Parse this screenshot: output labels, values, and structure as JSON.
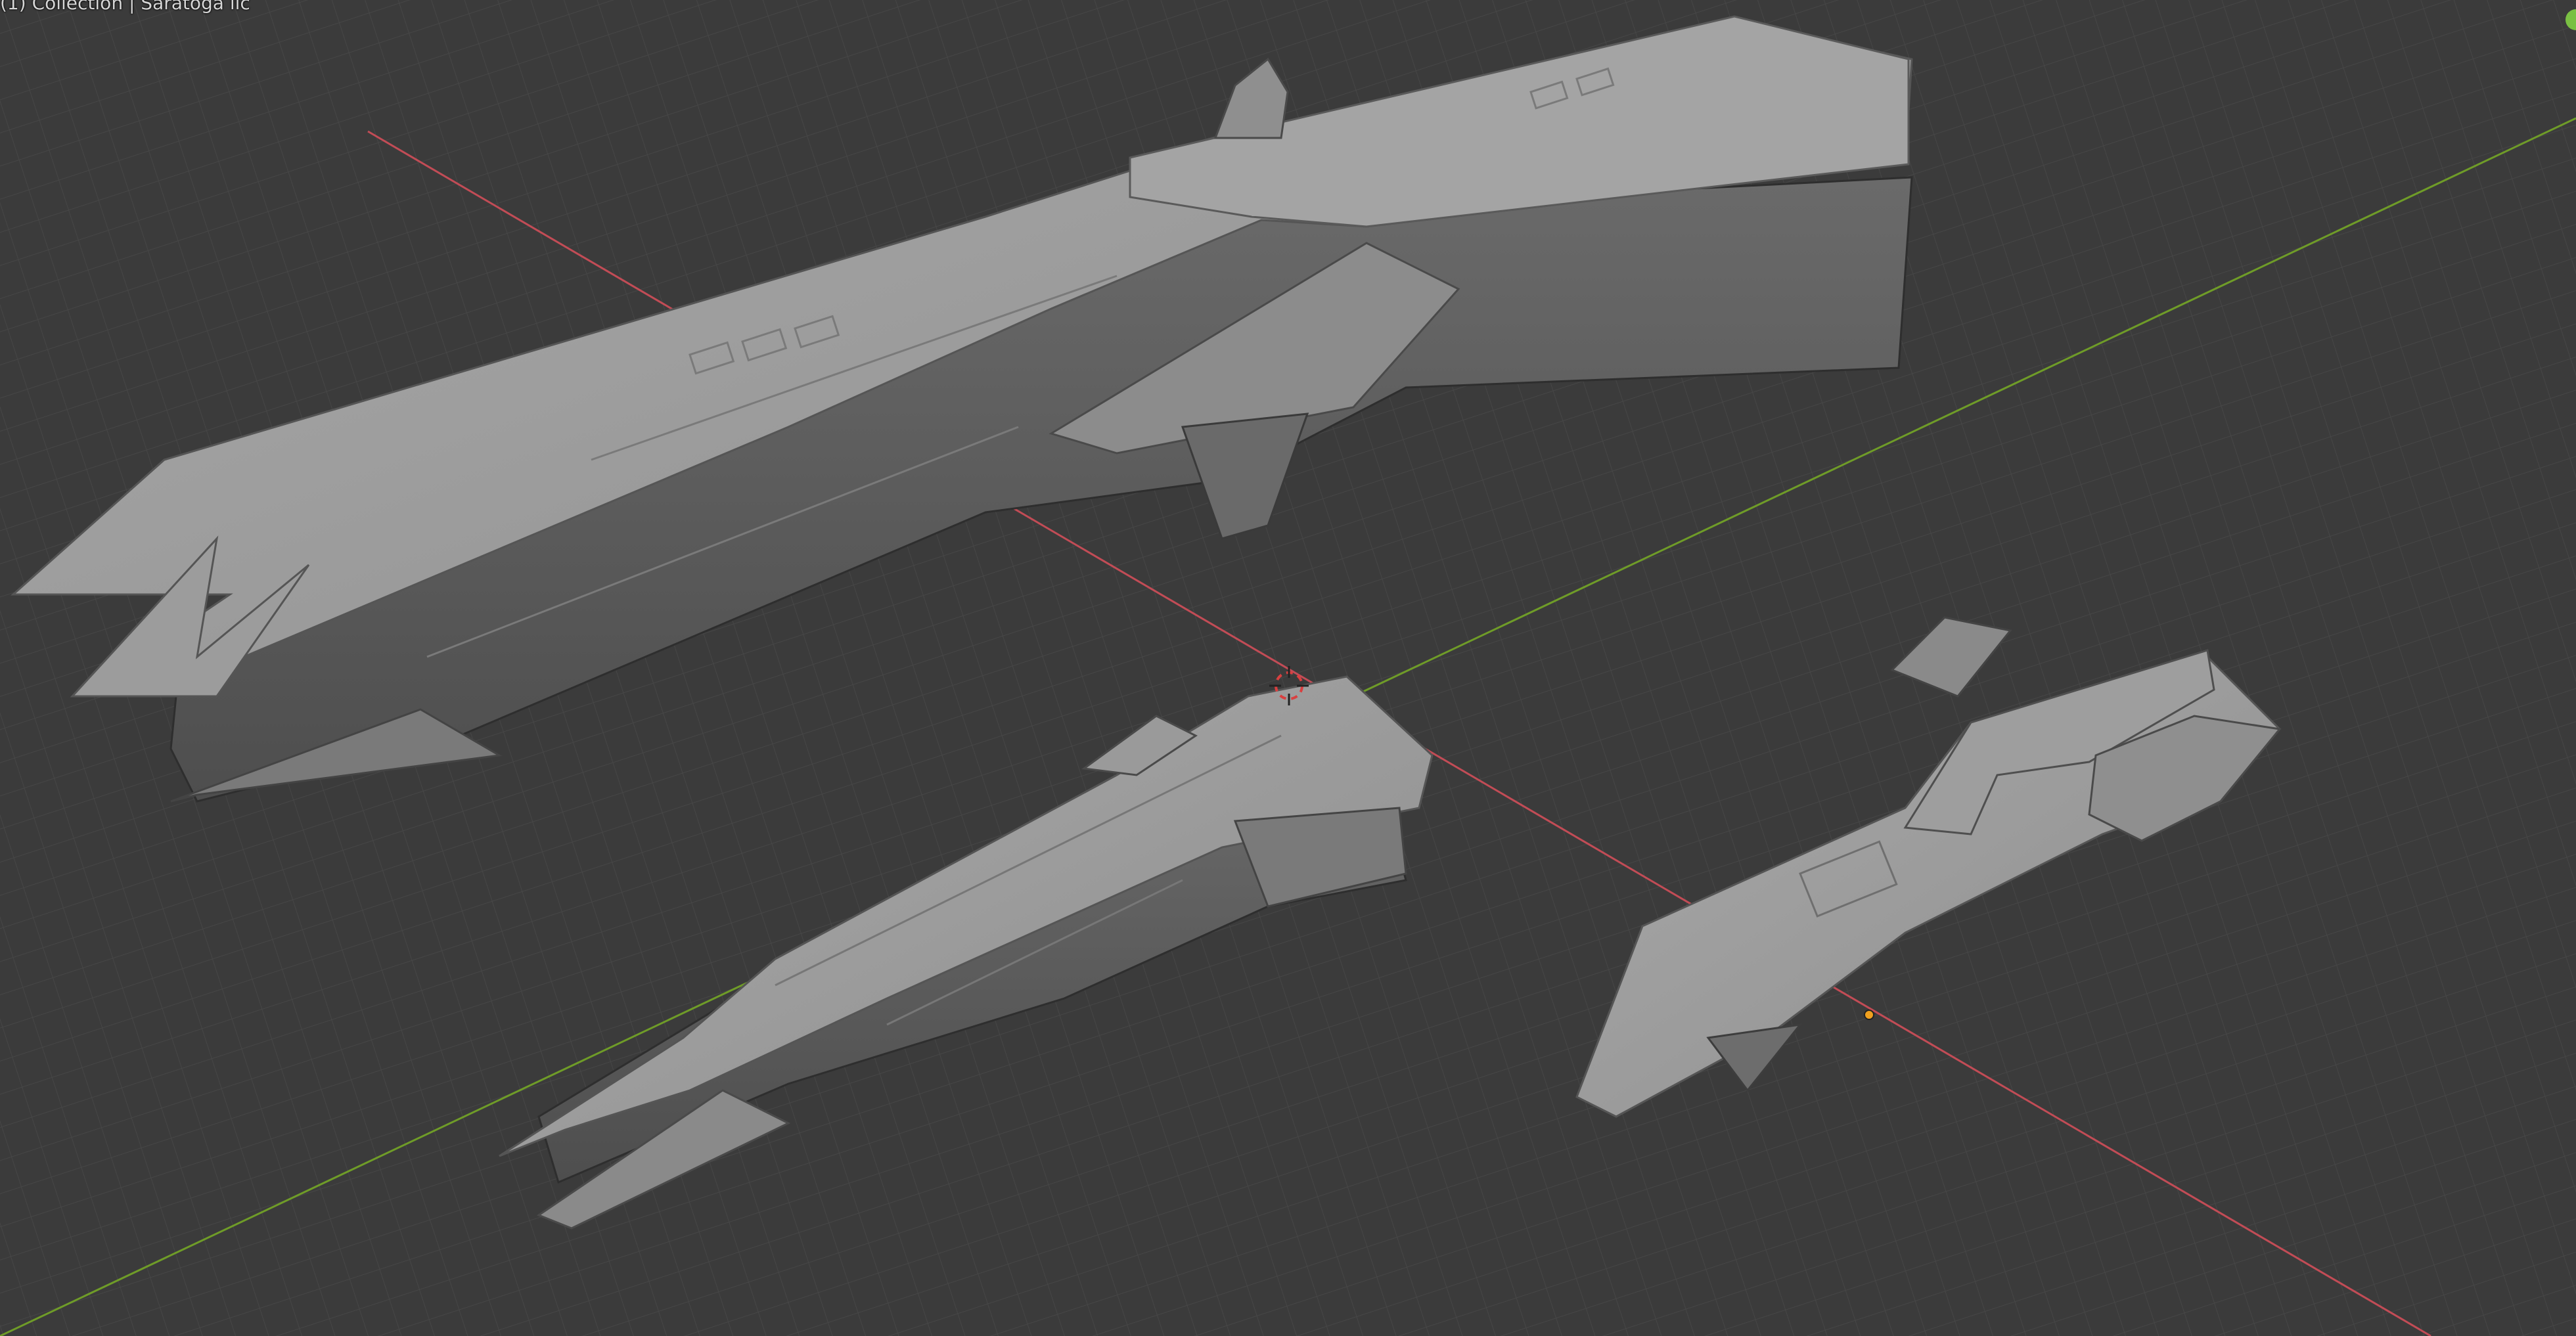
{
  "viewport": {
    "overlay_text": "(1) Collection | Saratoga llc",
    "background_color": "#3b3b3b",
    "grid_color": "#454545",
    "x_axis_color": "#c24c56",
    "y_axis_color": "#6f9c28",
    "gizmo_color": "#7ac043",
    "objects": [
      {
        "name": "large-carrier-ship",
        "kind": "mesh"
      },
      {
        "name": "medium-cruiser-ship",
        "kind": "mesh"
      },
      {
        "name": "small-frigate-ship",
        "kind": "mesh"
      }
    ],
    "markers": [
      {
        "name": "3d-cursor",
        "kind": "cursor"
      },
      {
        "name": "object-origin",
        "kind": "origin",
        "color": "#f0a01e"
      }
    ]
  }
}
